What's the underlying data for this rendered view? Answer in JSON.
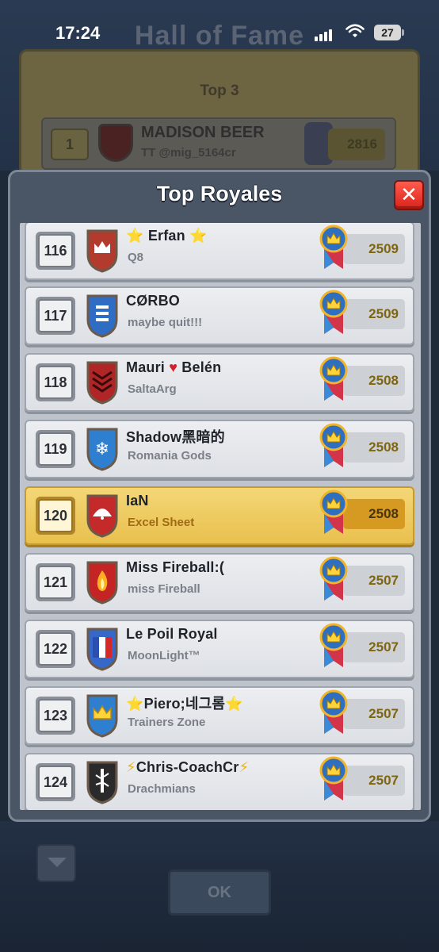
{
  "status_bar": {
    "time": "17:24",
    "battery": "27"
  },
  "background": {
    "title": "Hall of Fame",
    "section": "Top 3",
    "top_player": {
      "rank": "1",
      "name": "MADISON BEER",
      "clan": "TT @mig_5164cr",
      "trophies": "2816"
    },
    "ok_label": "OK"
  },
  "modal": {
    "title": "Top Royales",
    "close_icon": "close-x-icon",
    "rows": [
      {
        "rank": "116",
        "name_prefix": "⭐",
        "name": " Erfan ",
        "name_suffix": "⭐",
        "clan": "Q8",
        "trophies": "2509",
        "badge": "crown",
        "badge_color": "#b23b2e",
        "highlight": false
      },
      {
        "rank": "117",
        "name_prefix": "",
        "name": "CØRBO",
        "name_suffix": "",
        "clan": "maybe quit!!!",
        "trophies": "2509",
        "badge": "bars",
        "badge_color": "#2f6cc4",
        "highlight": false
      },
      {
        "rank": "118",
        "name_prefix": "",
        "name": "Mauri ",
        "heart": "♥",
        "name_after_heart": " Belén",
        "clan": "SaltaArg",
        "trophies": "2508",
        "badge": "chevrons",
        "badge_color": "#b02626",
        "highlight": false
      },
      {
        "rank": "119",
        "name_prefix": "",
        "name": "Shadow黑暗的",
        "name_suffix": "",
        "clan": "Romania Gods",
        "trophies": "2508",
        "badge": "snowflake",
        "badge_color": "#2f7fd0",
        "highlight": false
      },
      {
        "rank": "120",
        "name_prefix": "",
        "name": "IaN",
        "name_suffix": "",
        "clan": "Excel Sheet",
        "trophies": "2508",
        "badge": "fan",
        "badge_color": "#c42a2a",
        "highlight": true
      },
      {
        "rank": "121",
        "name_prefix": "",
        "name": "Miss Fireball:(",
        "name_suffix": "",
        "clan": "miss Fireball",
        "trophies": "2507",
        "badge": "flame",
        "badge_color": "#c42424",
        "highlight": false
      },
      {
        "rank": "122",
        "name_prefix": "",
        "name": "Le Poil Royal",
        "name_suffix": "",
        "clan": "MoonLight™",
        "trophies": "2507",
        "badge": "flag",
        "badge_color": "#3568c8",
        "highlight": false
      },
      {
        "rank": "123",
        "name_prefix": "⭐",
        "name": "Piero;네그롬",
        "name_suffix": "⭐",
        "clan": "Trainers Zone",
        "trophies": "2507",
        "badge": "crown-blue",
        "badge_color": "#2f7fd0",
        "highlight": false
      },
      {
        "rank": "124",
        "name_prefix": "⚡",
        "name": "Chris-CoachCr",
        "name_suffix": "⚡",
        "clan": "Drachmians",
        "trophies": "2507",
        "badge": "bamboo",
        "badge_color": "#2a2a2a",
        "highlight": false
      }
    ]
  },
  "colors": {
    "accent_gold": "#e9c04e",
    "close_red": "#d9241b",
    "trophy_text": "#7d6512"
  }
}
